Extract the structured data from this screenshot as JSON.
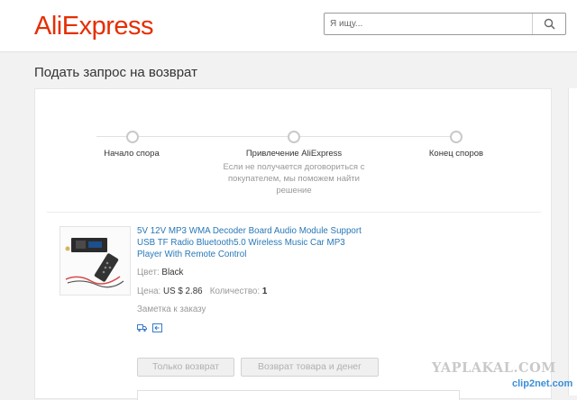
{
  "header": {
    "logo": "AliExpress",
    "search_placeholder": "Я ищу...",
    "search_icon": "search-icon",
    "brand_color": "#e62e04"
  },
  "page": {
    "title": "Подать запрос на возврат"
  },
  "steps": [
    {
      "label": "Начало спора"
    },
    {
      "label": "Привлечение AliExpress",
      "description": "Если не получается договориться с покупателем, мы поможем найти решение"
    },
    {
      "label": "Конец споров"
    }
  ],
  "product": {
    "title": "5V 12V MP3 WMA Decoder Board Audio Module Support USB TF Radio Bluetooth5.0 Wireless Music Car MP3 Player With Remote Control",
    "color_label": "Цвет:",
    "color_value": "Black",
    "price_label": "Цена:",
    "price_value": "US $ 2.86",
    "quantity_label": "Количество:",
    "quantity_value": "1",
    "order_note": "Заметка к заказу",
    "icons": [
      "delivery-icon",
      "return-icon"
    ],
    "link_color": "#2878b7"
  },
  "buttons": {
    "refund_only": "Только возврат",
    "return_and_refund": "Возврат товара и денег"
  },
  "watermarks": {
    "yaplakal": "YAPLAKAL.COM",
    "clip2net": "clip2net.com"
  }
}
